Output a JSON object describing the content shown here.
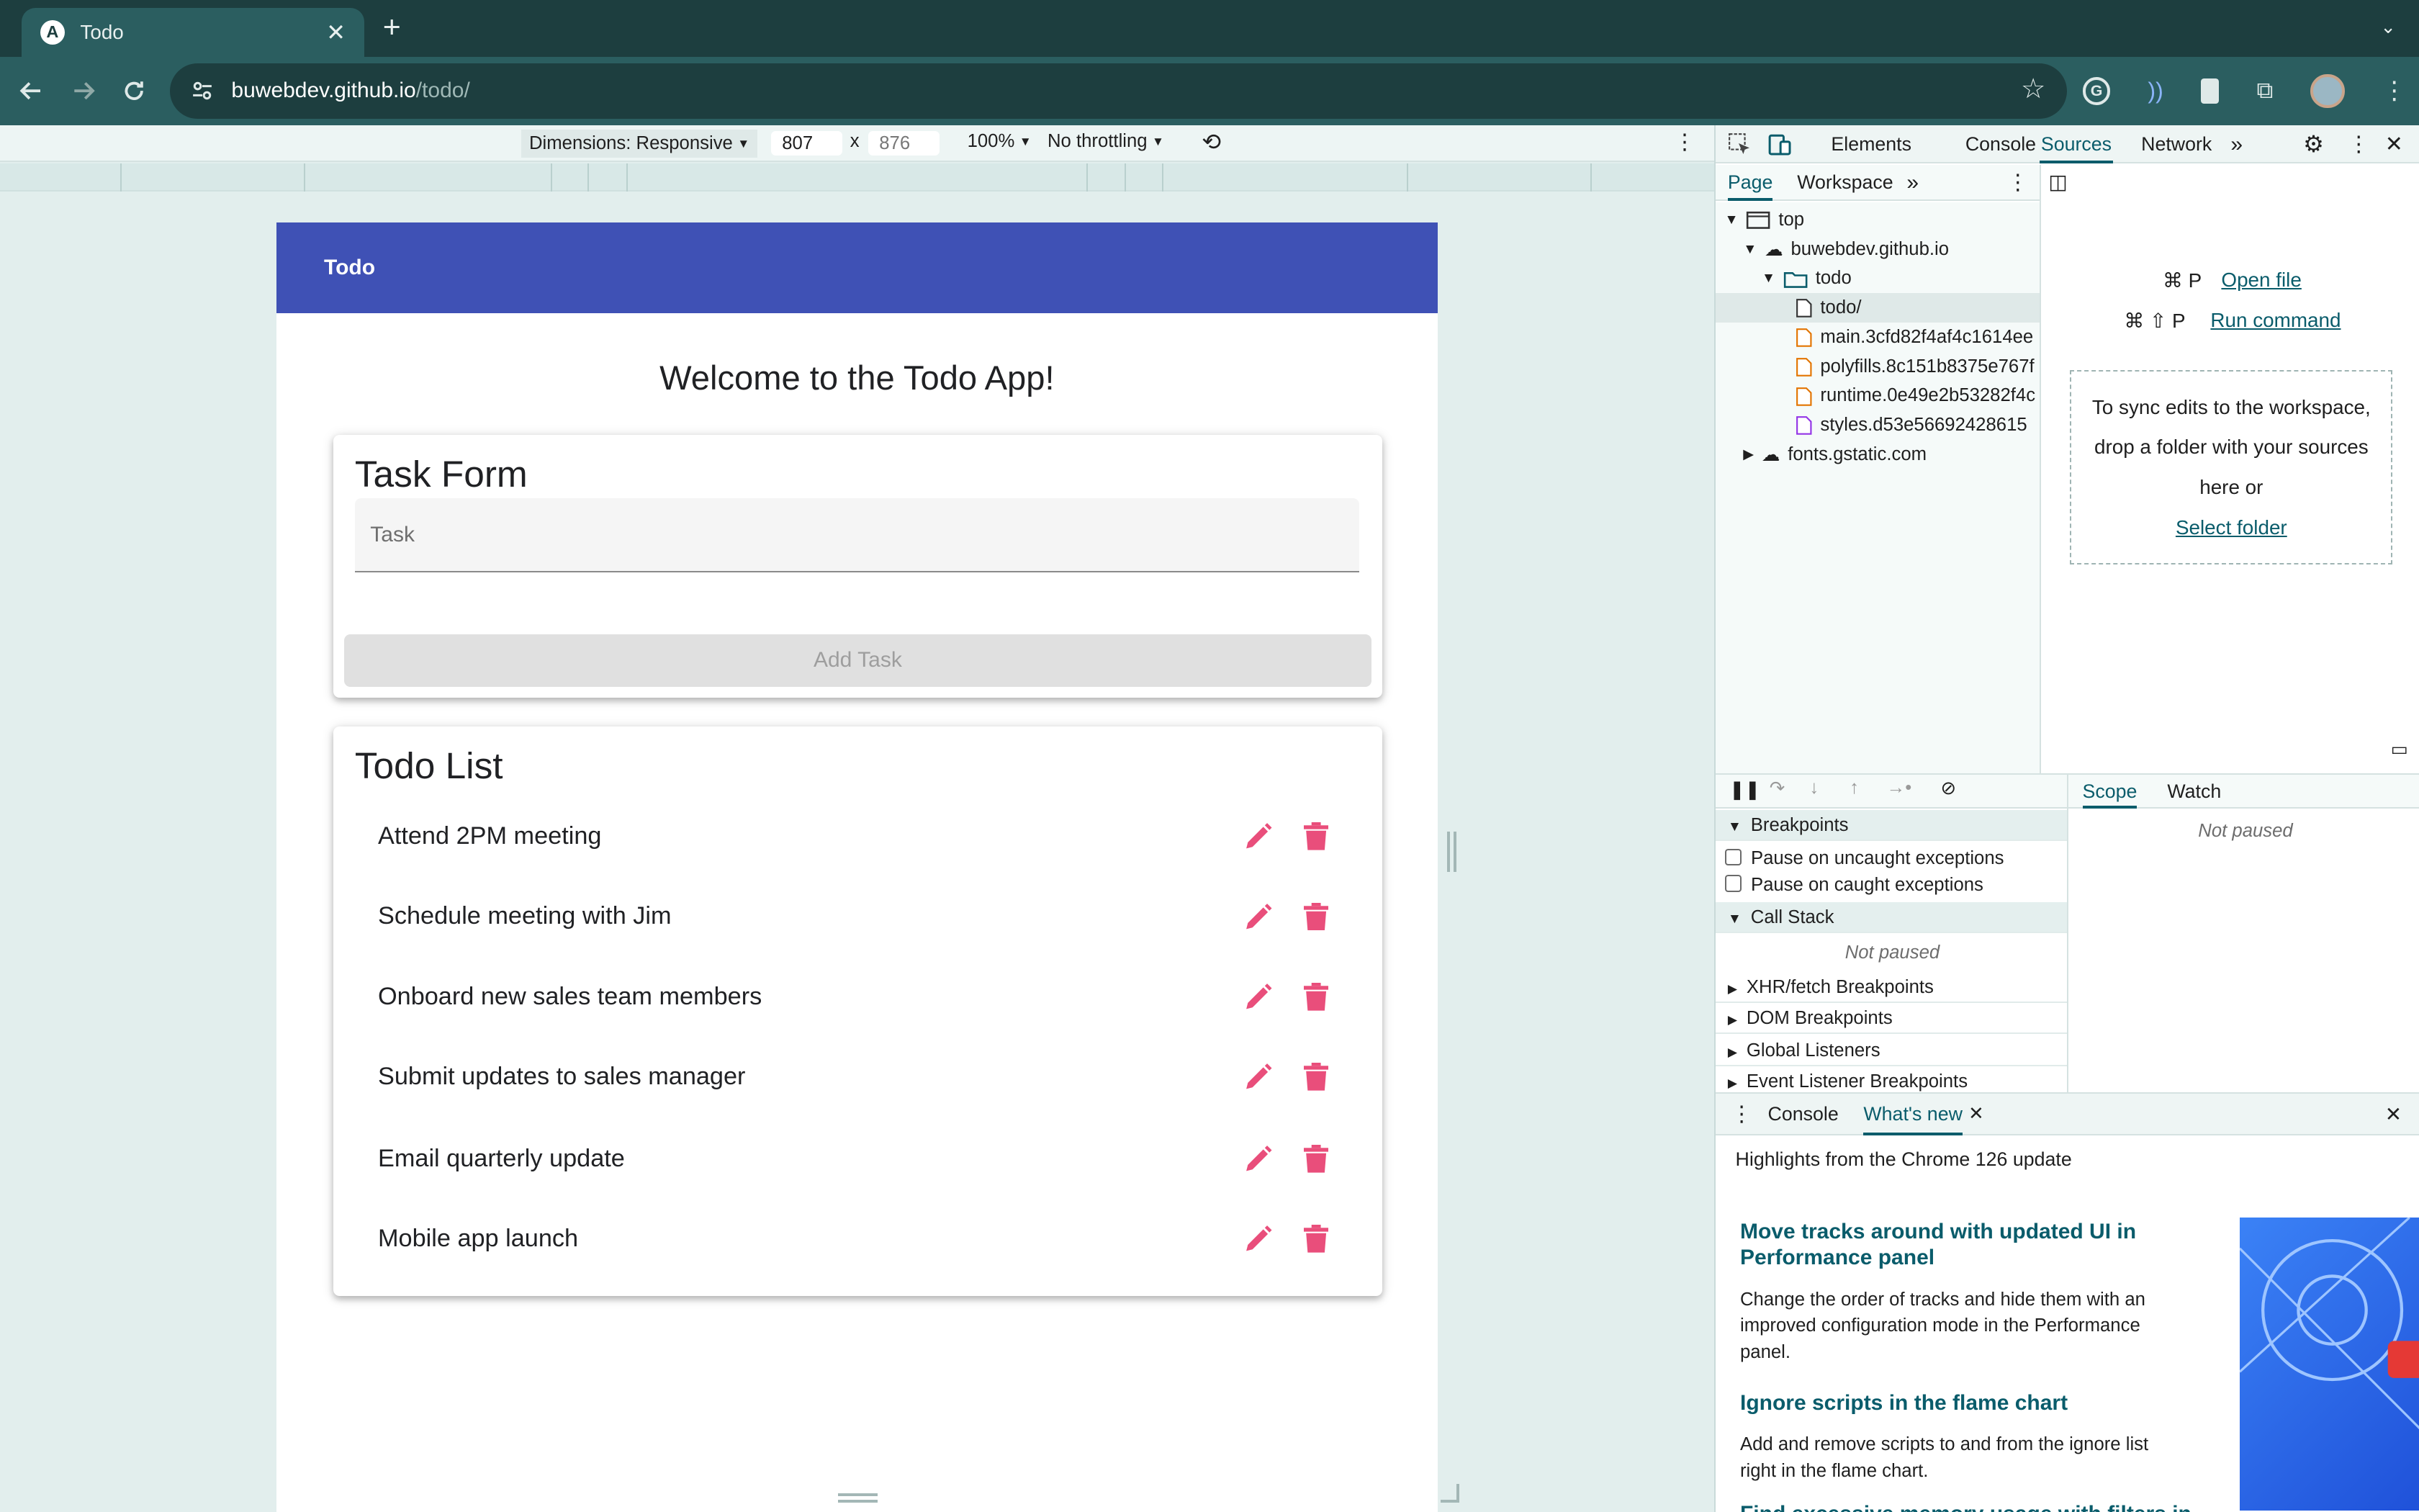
{
  "browser": {
    "tab_title": "Todo",
    "tab_favicon": "A",
    "url_host": "buwebdev.github.io",
    "url_path": "/todo/"
  },
  "device_toolbar": {
    "dimensions": "Dimensions: Responsive",
    "width": "807",
    "times": "x",
    "height": "876",
    "zoom": "100%",
    "throttling": "No throttling"
  },
  "app": {
    "toolbar_title": "Todo",
    "welcome": "Welcome to the Todo App!",
    "form_title": "Task Form",
    "task_placeholder": "Task",
    "add_button": "Add Task",
    "list_title": "Todo List",
    "todos": [
      "Attend 2PM meeting",
      "Schedule meeting with Jim",
      "Onboard new sales team members",
      "Submit updates to sales manager",
      "Email quarterly update",
      "Mobile app launch"
    ],
    "accent": "#3f51b5",
    "icon_color": "#e94e7b"
  },
  "devtools": {
    "tabs": [
      "Elements",
      "Console",
      "Sources",
      "Network"
    ],
    "sources_subtabs": [
      "Page",
      "Workspace"
    ],
    "tree": {
      "top": "top",
      "host": "buwebdev.github.io",
      "folder": "todo",
      "files": [
        "todo/",
        "main.3cfd82f4af4c1614ee",
        "polyfills.8c151b8375e767f",
        "runtime.0e49e2b53282f4c",
        "styles.d53e56692428615"
      ],
      "fonts": "fonts.gstatic.com"
    },
    "shortcuts": [
      {
        "keys": "⌘ P",
        "label": "Open file"
      },
      {
        "keys": "⌘ ⇧ P",
        "label": "Run command"
      }
    ],
    "drop_text": "To sync edits to the workspace, drop a folder with your sources here or",
    "drop_link": "Select folder",
    "debugger": {
      "breakpoints": "Breakpoints",
      "pause_uncaught": "Pause on uncaught exceptions",
      "pause_caught": "Pause on caught exceptions",
      "call_stack": "Call Stack",
      "not_paused": "Not paused",
      "xhr": "XHR/fetch Breakpoints",
      "dom": "DOM Breakpoints",
      "global": "Global Listeners",
      "event": "Event Listener Breakpoints",
      "scope": "Scope",
      "watch": "Watch"
    },
    "drawer": {
      "console": "Console",
      "whats_new": "What's new",
      "highlights": "Highlights from the Chrome 126 update",
      "h1": "Move tracks around with updated UI in Performance panel",
      "p1": "Change the order of tracks and hide them with an improved configuration mode in the Performance panel.",
      "h2": "Ignore scripts in the flame chart",
      "p2": "Add and remove scripts to and from the ignore list right in the flame chart.",
      "h3": "Find excessive memory usage with filters in"
    }
  }
}
